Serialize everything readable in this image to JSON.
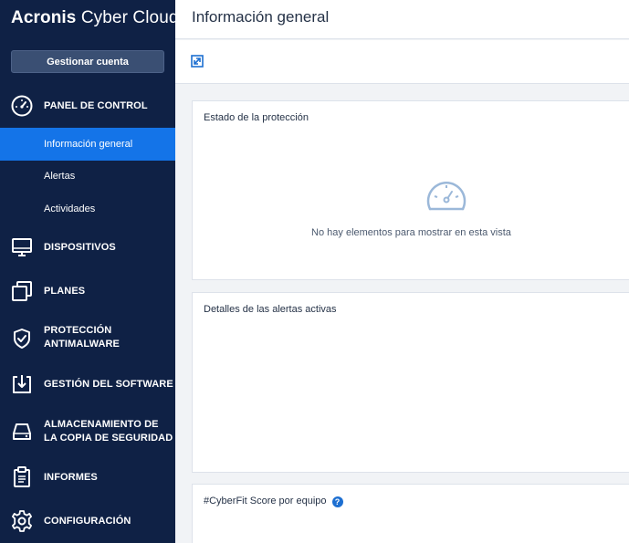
{
  "sidebar": {
    "brand": {
      "part1": "Acronis",
      "part2": " Cyber Cloud"
    },
    "manage_button": "Gestionar cuenta",
    "sections": {
      "dashboard": "PANEL DE CONTROL",
      "devices": "DISPOSITIVOS",
      "plans": "PLANES",
      "antimalware_line1": "PROTECCIÓN",
      "antimalware_line2": "ANTIMALWARE",
      "software": "GESTIÓN DEL SOFTWARE",
      "storage_line1": "ALMACENAMIENTO DE",
      "storage_line2": "LA COPIA DE SEGURIDAD",
      "reports": "INFORMES",
      "settings": "CONFIGURACIÓN"
    },
    "subitems": {
      "overview": "Información general",
      "alerts": "Alertas",
      "activities": "Actividades"
    },
    "active_item": "Información general"
  },
  "header": {
    "title": "Información general"
  },
  "widgets": {
    "protection": {
      "title": "Estado de la protección",
      "empty_message": "No hay elementos para mostrar en esta vista"
    },
    "alerts": {
      "title": "Detalles de las alertas activas"
    },
    "cyberfit": {
      "title": "#CyberFit Score por equipo",
      "help": "?"
    }
  },
  "colors": {
    "sidebar_bg": "#0f2145",
    "active_item": "#1474e8",
    "accent": "#1d6fd1"
  }
}
